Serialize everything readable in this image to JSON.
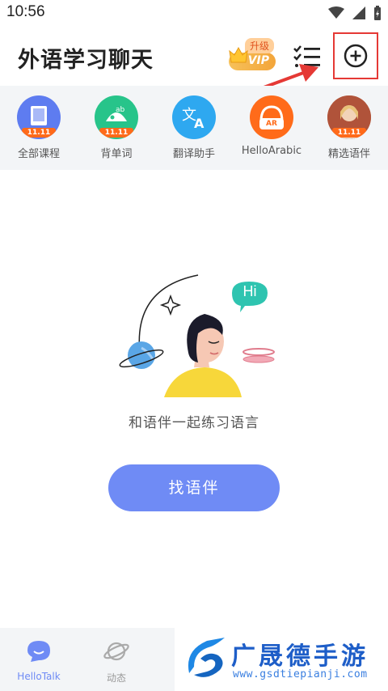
{
  "status_bar": {
    "time": "10:56"
  },
  "header": {
    "title": "外语学习聊天",
    "vip_upgrade_label": "升级",
    "vip_label": "VIP"
  },
  "shortcuts": [
    {
      "label": "全部课程",
      "tag": "11.11",
      "icon": "book-icon",
      "color": "#5e7cf0"
    },
    {
      "label": "背单词",
      "tag": "11.11",
      "icon": "word-icon",
      "color": "#27c48a"
    },
    {
      "label": "翻译助手",
      "icon": "translate-icon",
      "color": "#2ea8f0"
    },
    {
      "label": "HelloArabic",
      "icon": "headphones-icon",
      "icon_text": "AR",
      "color": "#ff6b1a"
    },
    {
      "label": "精选语伴",
      "tag": "11.11",
      "icon": "partner-avatar-icon"
    }
  ],
  "empty_state": {
    "bubble_text": "Hi",
    "message": "和语伴一起练习语言",
    "button_label": "找语伴"
  },
  "tabbar": {
    "items": [
      {
        "label": "HelloTalk",
        "icon": "chat-bubble-icon",
        "active": true
      },
      {
        "label": "动态",
        "icon": "planet-icon",
        "active": false
      }
    ]
  },
  "watermark": {
    "title": "广晟德手游",
    "url": "www.gsdtiepianji.com"
  },
  "colors": {
    "accent": "#6f8bf5",
    "highlight_box": "#e53935",
    "shortcut_bg": "#f3f5f7"
  }
}
